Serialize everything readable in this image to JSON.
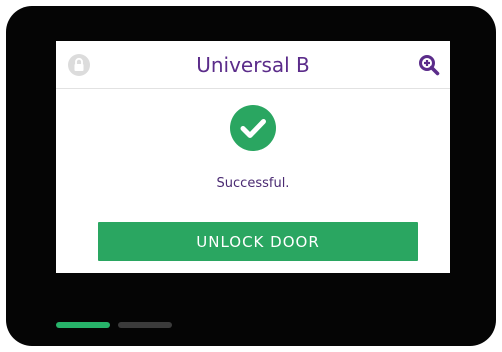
{
  "header": {
    "title": "Universal B",
    "left_icon": "lock-icon",
    "right_icon": "zoom-in-icon"
  },
  "status": {
    "icon": "check-circle-icon",
    "message": "Successful."
  },
  "actions": {
    "unlock_label": "UNLOCK DOOR"
  },
  "pager": {
    "pages": 2,
    "active_page": 1
  },
  "colors": {
    "bezel": "#050505",
    "title": "#5b2c8a",
    "success": "#2aa661",
    "pager_active": "#27b36a",
    "pager_inactive": "#3b3b3b",
    "lock_icon": "#d9d9d9"
  }
}
